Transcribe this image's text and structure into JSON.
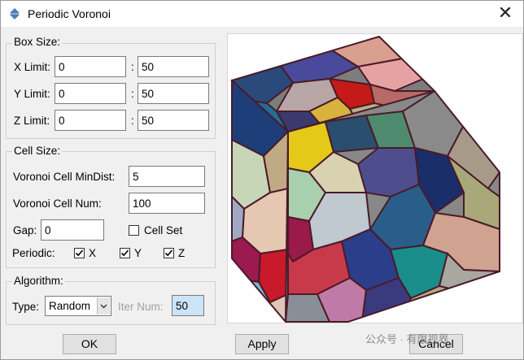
{
  "window": {
    "title": "Periodic Voronoi",
    "close_glyph": "✕"
  },
  "box_size": {
    "legend": "Box Size:",
    "x_label": "X Limit:",
    "x_min": "0",
    "x_max": "50",
    "y_label": "Y Limit:",
    "y_min": "0",
    "y_max": "50",
    "z_label": "Z Limit:",
    "z_min": "0",
    "z_max": "50",
    "separator": ":"
  },
  "cell_size": {
    "legend": "Cell Size:",
    "mindist_label": "Voronoi Cell MinDist:",
    "mindist_value": "5",
    "num_label": "Voronoi Cell Num:",
    "num_value": "100",
    "gap_label": "Gap:",
    "gap_value": "0",
    "cellset_label": "Cell Set",
    "cellset_checked": false,
    "periodic_label": "Periodic:",
    "periodic_x_label": "X",
    "periodic_x_checked": true,
    "periodic_y_label": "Y",
    "periodic_y_checked": true,
    "periodic_z_label": "Z",
    "periodic_z_checked": true
  },
  "algorithm": {
    "legend": "Algorithm:",
    "type_label": "Type:",
    "type_value": "Random",
    "iter_label": "Iter Num:",
    "iter_value": "50"
  },
  "buttons": {
    "ok": "OK",
    "apply": "Apply",
    "cancel": "Cancel"
  },
  "watermark": "公众号 · 有限视界",
  "colors": {
    "accent": "#cce4f7",
    "outline": "#4a1a28"
  }
}
